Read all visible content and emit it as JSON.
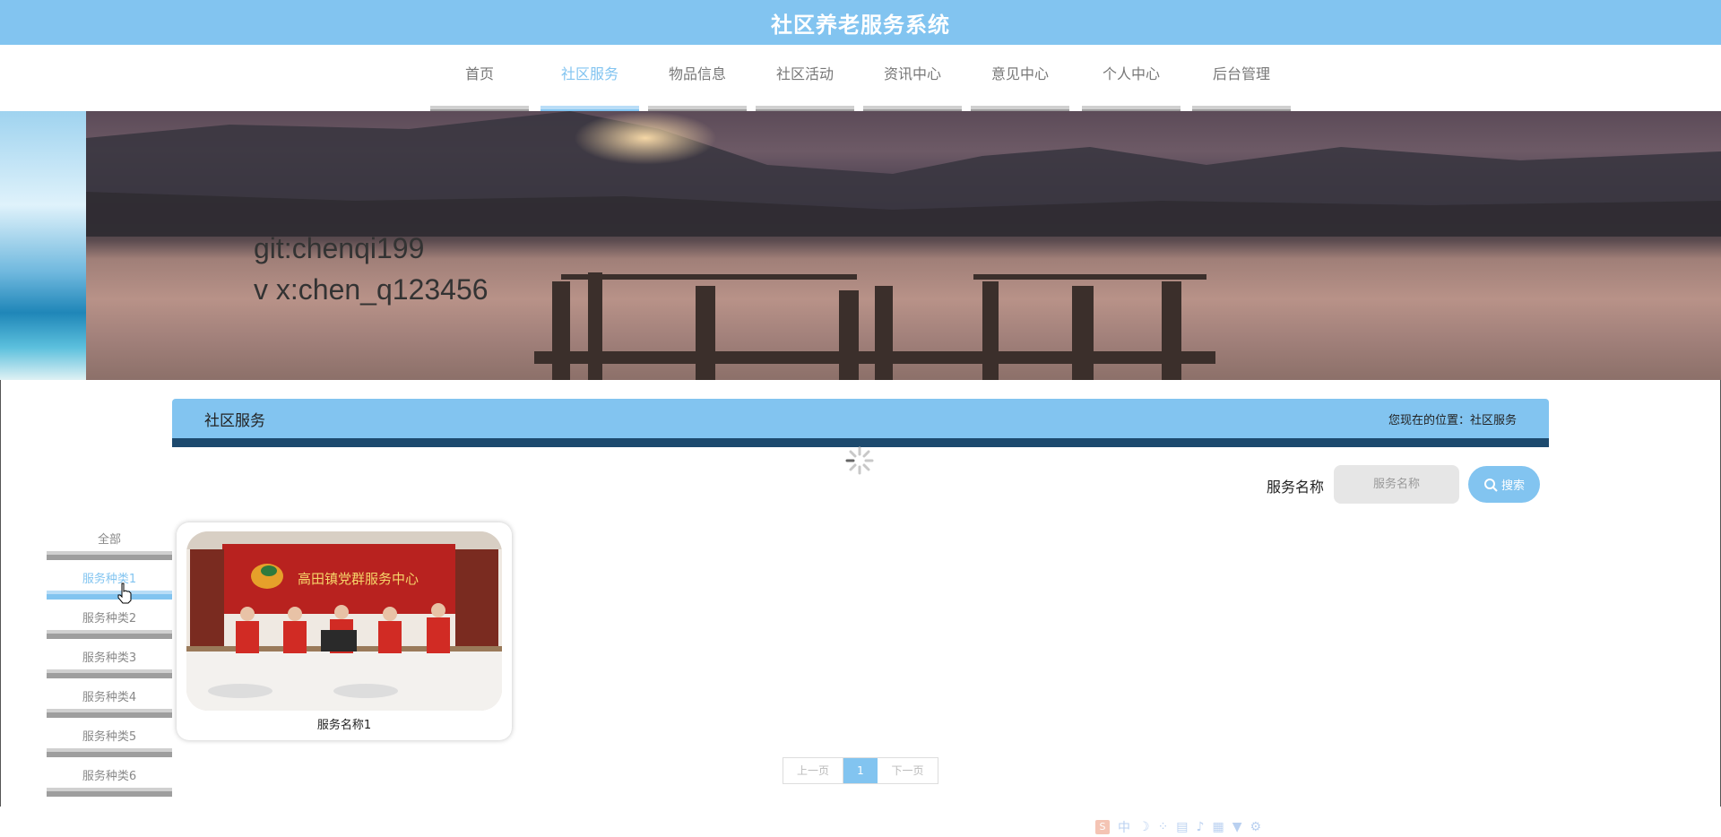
{
  "header": {
    "title": "社区养老服务系统"
  },
  "nav": {
    "items": [
      {
        "label": "首页"
      },
      {
        "label": "社区服务"
      },
      {
        "label": "物品信息"
      },
      {
        "label": "社区活动"
      },
      {
        "label": "资讯中心"
      },
      {
        "label": "意见中心"
      },
      {
        "label": "个人中心"
      },
      {
        "label": "后台管理"
      }
    ],
    "active": "社区服务"
  },
  "banner": {
    "line1": "git:chenqi199",
    "line2": "v x:chen_q123456"
  },
  "section": {
    "title": "社区服务",
    "breadcrumb": "您现在的位置：社区服务"
  },
  "search": {
    "label": "服务名称",
    "placeholder": "服务名称",
    "button": "搜索"
  },
  "categories": [
    {
      "label": "全部"
    },
    {
      "label": "服务种类1"
    },
    {
      "label": "服务种类2"
    },
    {
      "label": "服务种类3"
    },
    {
      "label": "服务种类4"
    },
    {
      "label": "服务种类5"
    },
    {
      "label": "服务种类6"
    }
  ],
  "cards": [
    {
      "name": "服务名称1",
      "photo_text": "高田镇党群服务中心"
    }
  ],
  "pagination": {
    "prev": "上一页",
    "current": "1",
    "next": "下一页"
  },
  "ime": {
    "text": "中"
  },
  "colors": {
    "accent": "#82c4f0",
    "dark_bar": "#1d4a6e"
  }
}
